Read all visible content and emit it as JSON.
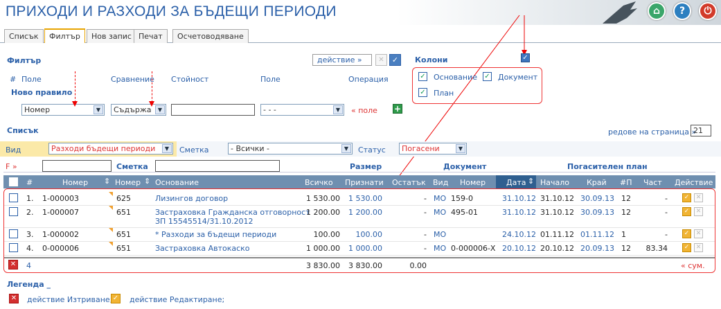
{
  "header": {
    "title": "ПРИХОДИ И РАЗХОДИ ЗА БЪДЕЩИ ПЕРИОДИ"
  },
  "header_buttons": [
    {
      "name": "home-icon",
      "color": "#3aa66a",
      "glyph": "⌂"
    },
    {
      "name": "help-icon",
      "color": "#2c7fc0",
      "glyph": "?"
    },
    {
      "name": "power-icon",
      "color": "#d23a2a",
      "glyph": "⏻"
    }
  ],
  "tabs": [
    "Списък",
    "Филтър",
    "Нов запис",
    "Печат",
    "Осчетоводяване"
  ],
  "filter": {
    "title": "Филтър",
    "action_label": "действие »",
    "columns": {
      "hash": "#",
      "field": "Поле",
      "comparison": "Сравнение",
      "value": "Стойност",
      "field2": "Поле",
      "operation": "Операция"
    },
    "new_rule": "Ново правило",
    "field_value": "Номер",
    "comparison_value": "Съдържа",
    "field2_value": "- - -",
    "add_field_link": "« поле"
  },
  "columns_panel": {
    "title": "Колони",
    "items": [
      "Основание",
      "Документ",
      "План"
    ]
  },
  "list": {
    "title": "Списък",
    "rows_per_page_label": "редове на страница »",
    "rows_per_page_value": "21",
    "view_label": "Вид",
    "view_value": "Разходи бъдещи периоди",
    "account_label": "Сметка",
    "account_value": "- Всички -",
    "status_label": "Статус",
    "status_value": "Погасени",
    "filter_toggle": "F »"
  },
  "table": {
    "group_headers": {
      "account": "Сметка",
      "size": "Размер",
      "document": "Документ",
      "plan": "Погасителен план"
    },
    "headers": [
      "#",
      "Номер",
      "Номер",
      "Основание",
      "Всичко",
      "Признати",
      "Остатък",
      "Вид",
      "Номер",
      "Дата",
      "Начало",
      "Край",
      "#П",
      "Част",
      "Действие"
    ],
    "rows": [
      {
        "idx": "1.",
        "number": "1-000003",
        "account": "625",
        "basis": "Лизингов договор",
        "basis2": "",
        "total": "1 530.00",
        "recognized": "1 530.00",
        "remainder": "-",
        "kind": "МО",
        "doc_no": "159-0",
        "date": "31.10.12",
        "start": "31.10.12",
        "end": "30.09.13",
        "np": "12",
        "part": "-"
      },
      {
        "idx": "2.",
        "number": "1-000007",
        "account": "651",
        "basis": "Застраховка Гражданска отговорност",
        "basis2": "ЗП 15545514/31.10.2012",
        "total": "1 200.00",
        "recognized": "1 200.00",
        "remainder": "-",
        "kind": "МО",
        "doc_no": "495-01",
        "date": "31.10.12",
        "start": "31.10.12",
        "end": "30.09.13",
        "np": "12",
        "part": "-"
      },
      {
        "idx": "3.",
        "number": "1-000002",
        "account": "651",
        "basis": "* Разходи за бъдещи периоди",
        "basis2": "",
        "total": "100.00",
        "recognized": "100.00",
        "remainder": "-",
        "kind": "МО",
        "doc_no": "",
        "date": "24.10.12",
        "start": "01.11.12",
        "end": "01.11.12",
        "np": "1",
        "part": "-"
      },
      {
        "idx": "4.",
        "number": "0-000006",
        "account": "651",
        "basis": "Застраховка Автокаско",
        "basis2": "",
        "total": "1 000.00",
        "recognized": "1 000.00",
        "remainder": "-",
        "kind": "МО",
        "doc_no": "0-000006-Х",
        "date": "20.10.12",
        "start": "20.10.12",
        "end": "20.09.13",
        "np": "12",
        "part": "83.34"
      }
    ],
    "footer": {
      "count": "4",
      "total": "3 830.00",
      "recognized": "3 830.00",
      "remainder": "0.00",
      "sum_link": "« сум."
    }
  },
  "legend": {
    "title": "Легенда _",
    "delete": "действие Изтриване;",
    "edit": "действие Редактиране;"
  }
}
